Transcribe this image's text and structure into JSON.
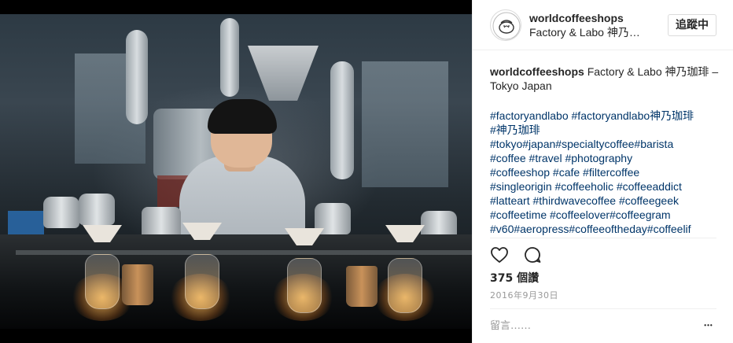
{
  "post": {
    "photo_alt": "Barista pouring filter coffee at Factory & Labo",
    "header": {
      "username": "worldcoffeeshops",
      "location": "Factory & Labo 神乃…",
      "follow_label": "追蹤中"
    },
    "caption": {
      "author": "worldcoffeeshops",
      "text": "Factory & Labo 神乃珈琲 – Tokyo Japan"
    },
    "hashtags": [
      "#factoryandlabo #factoryandlabo神乃珈琲",
      "#神乃珈琲",
      "#tokyo#japan#specialtycoffee#barista",
      "#coffee #travel #photography",
      "#coffeeshop #cafe #filtercoffee",
      "#singleorigin #coffeeholic #coffeeaddict",
      "#latteart #thirdwavecoffee #coffeegeek",
      "#coffeetime #coffeelover#coffeegram",
      "#v60#aeropress#coffeeoftheday#coffeelif"
    ],
    "likes": "375 個讚",
    "date": "2016年9月30日",
    "comment_placeholder": "留言……",
    "more_label": "•••"
  },
  "icons": {
    "like": "heart-outline-icon",
    "comment": "comment-bubble-icon",
    "more": "more-options-icon"
  },
  "colors": {
    "hashtag": "#003569",
    "text": "#262626",
    "muted": "#999999",
    "border": "#dbdbdb"
  }
}
